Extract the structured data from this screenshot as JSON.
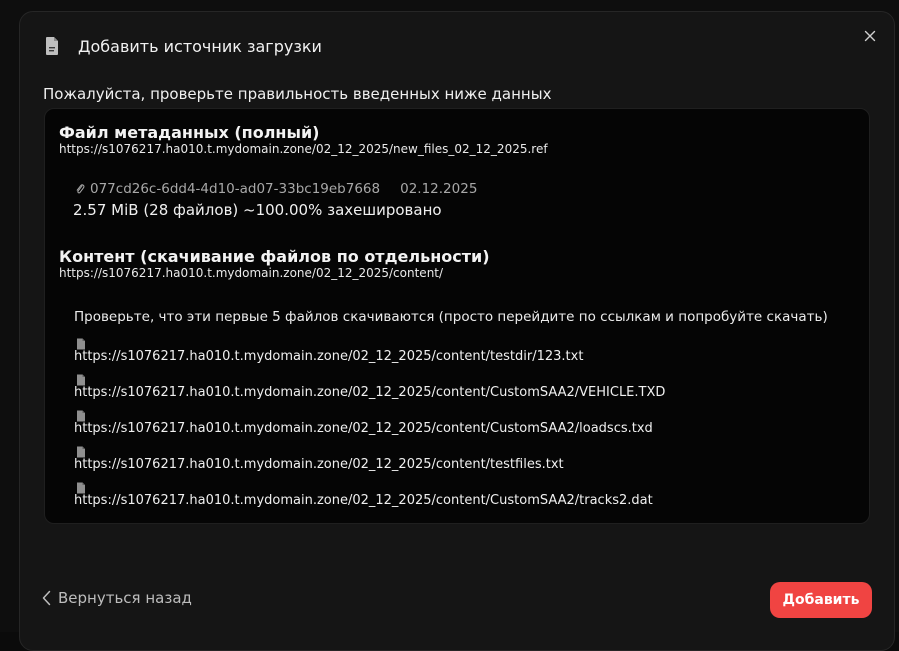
{
  "dialog": {
    "title": "Добавить источник загрузки",
    "header_icon": "document-icon",
    "close_icon": "close-icon"
  },
  "subtitle": "Пожалуйста, проверьте правильность введенных ниже данных",
  "metadata": {
    "title": "Файл метаданных (полный)",
    "url": "https://s1076217.ha010.t.mydomain.zone/02_12_2025/new_files_02_12_2025.ref",
    "id": "077cd26c-6dd4-4d10-ad07-33bc19eb7668",
    "date": "02.12.2025",
    "summary": "2.57 MiB (28 файлов) ~100.00% захешировано"
  },
  "content": {
    "title": "Контент (скачивание файлов по отдельности)",
    "url": "https://s1076217.ha010.t.mydomain.zone/02_12_2025/content/",
    "hint": "Проверьте, что эти первые 5 файлов скачиваются (просто перейдите по ссылкам и попробуйте скачать)",
    "files": [
      "https://s1076217.ha010.t.mydomain.zone/02_12_2025/content/testdir/123.txt",
      "https://s1076217.ha010.t.mydomain.zone/02_12_2025/content/CustomSAA2/VEHICLE.TXD",
      "https://s1076217.ha010.t.mydomain.zone/02_12_2025/content/CustomSAA2/loadscs.txd",
      "https://s1076217.ha010.t.mydomain.zone/02_12_2025/content/testfiles.txt",
      "https://s1076217.ha010.t.mydomain.zone/02_12_2025/content/CustomSAA2/tracks2.dat"
    ]
  },
  "footer": {
    "back_label": "Вернуться назад",
    "add_label": "Добавить"
  },
  "colors": {
    "accent": "#f04442",
    "dialog_bg": "#151515",
    "panel_bg": "#050505"
  }
}
